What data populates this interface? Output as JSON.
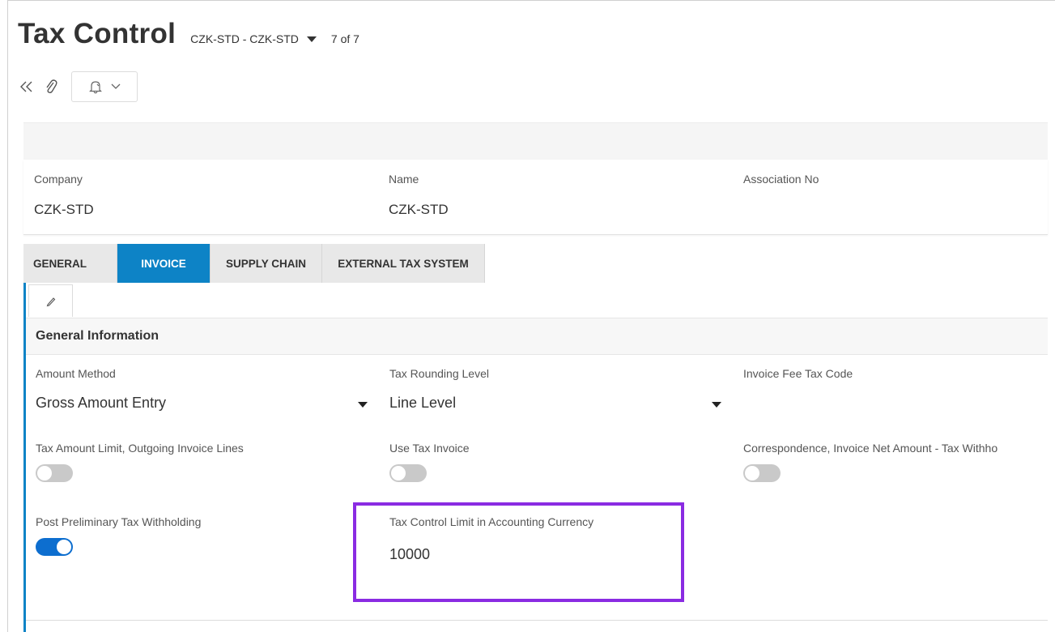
{
  "header": {
    "title": "Tax Control",
    "record_selector": "CZK-STD - CZK-STD",
    "record_count": "7 of 7"
  },
  "toolbar": {
    "collapse_icon": "double-chevron-left-icon",
    "attachment_icon": "paperclip-icon",
    "notification_icon": "bell-icon"
  },
  "summary": {
    "company_label": "Company",
    "company_value": "CZK-STD",
    "name_label": "Name",
    "name_value": "CZK-STD",
    "association_label": "Association No",
    "association_value": ""
  },
  "tabs": [
    {
      "label": "GENERAL"
    },
    {
      "label": "INVOICE"
    },
    {
      "label": "SUPPLY CHAIN"
    },
    {
      "label": "EXTERNAL TAX SYSTEM"
    }
  ],
  "section": {
    "title": "General Information"
  },
  "fields": {
    "amount_method_label": "Amount Method",
    "amount_method_value": "Gross Amount Entry",
    "tax_rounding_label": "Tax Rounding Level",
    "tax_rounding_value": "Line Level",
    "invoice_fee_label": "Invoice Fee Tax Code",
    "tax_amount_limit_label": "Tax Amount Limit, Outgoing Invoice Lines",
    "use_tax_invoice_label": "Use Tax Invoice",
    "correspondence_label": "Correspondence, Invoice Net Amount - Tax Withho",
    "post_preliminary_label": "Post Preliminary Tax Withholding",
    "tax_control_limit_label": "Tax Control Limit in Accounting Currency",
    "tax_control_limit_value": "10000"
  },
  "colors": {
    "accent": "#0d83c6",
    "toggle_on": "#0d6ecf",
    "highlight": "#8a2be2"
  }
}
